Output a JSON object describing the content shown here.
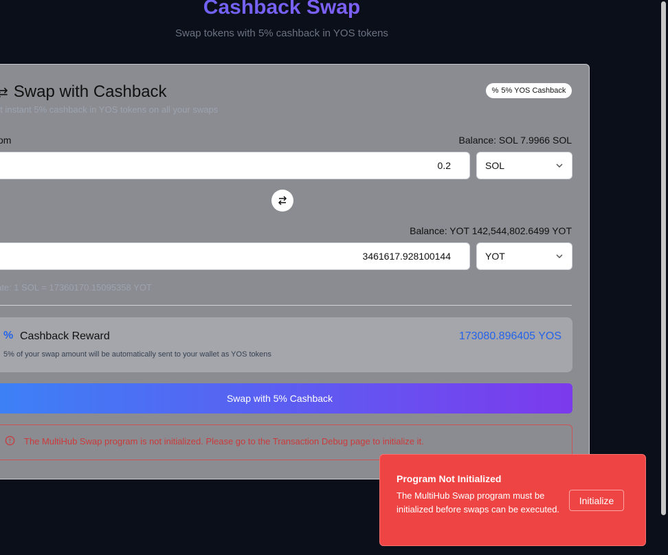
{
  "page": {
    "title": "Cashback Swap",
    "subtitle": "Swap tokens with 5% cashback in YOS tokens"
  },
  "card": {
    "title": "Swap with Cashback",
    "badge": "5% YOS Cashback",
    "description": "et instant 5% cashback in YOS tokens on all your swaps"
  },
  "from": {
    "label": "om",
    "balance": "Balance: SOL 7.9966 SOL",
    "amount": "0.2",
    "token": "SOL"
  },
  "to": {
    "label": "",
    "balance": "Balance: YOT 142,544,802.6499 YOT",
    "amount": "3461617.928100144",
    "token": "YOT"
  },
  "rate": "ate: 1 SOL = 17360170.15095358 YOT",
  "reward": {
    "title": "Cashback Reward",
    "amount": "173080.896405 YOS",
    "description": "5% of your swap amount will be automatically sent to your wallet as YOS tokens"
  },
  "actions": {
    "swap_label": "Swap with 5% Cashback"
  },
  "error": {
    "message": "The MultiHub Swap program is not initialized. Please go to the Transaction Debug page to initialize it."
  },
  "toast": {
    "title": "Program Not Initialized",
    "message": "The MultiHub Swap program must be initialized before swaps can be executed.",
    "action_label": "Initialize"
  },
  "colors": {
    "accent": "#6366f1",
    "reward": "#2563eb",
    "error": "#dc2626",
    "toast_bg": "#ef4444"
  }
}
